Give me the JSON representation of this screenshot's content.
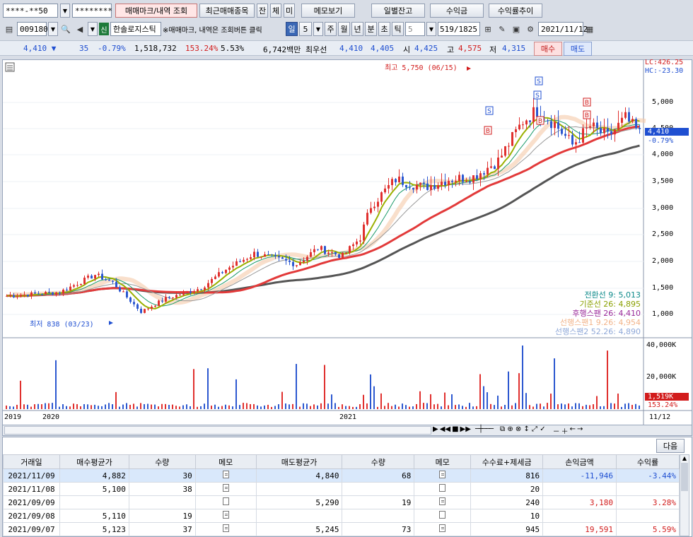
{
  "top": {
    "account": "****-**50",
    "password": "********",
    "btn_marks": "매매마크/내역 조회",
    "btn_recent": "최근매매종목",
    "btn_jan": "잔",
    "btn_che": "체",
    "btn_mi": "미",
    "btn_memo": "메모보기",
    "btn_daily": "일별잔고",
    "btn_profit": "수익금",
    "btn_rate": "수익률추이"
  },
  "stock": {
    "code": "009180",
    "badge": "신",
    "name": "한솔로지스틱",
    "hint": "※매매마크, 내역은 조회버튼 클릭",
    "periods": [
      "일",
      "5",
      "주",
      "월",
      "년",
      "분",
      "초",
      "틱"
    ],
    "interval": "5",
    "count": "519/1825",
    "date": "2021/11/12"
  },
  "quote": {
    "price": "4,410",
    "arrow": "▼",
    "change": "35",
    "rate": "-0.79%",
    "volume": "1,518,732",
    "vol_ratio": "153.24%",
    "turnover": "5.53%",
    "amount": "6,742백만",
    "best_label": "최우선",
    "bid": "4,410",
    "ask": "4,405",
    "open_label": "시",
    "open": "4,425",
    "high_label": "고",
    "high": "4,575",
    "low_label": "저",
    "low": "4,315",
    "buy_btn": "매수",
    "sell_btn": "매도"
  },
  "chart": {
    "lc": "LC:426.25",
    "hc": "HC:-23.30",
    "max_label": "최고 5,750 (06/15)",
    "min_label": "최저 838 (03/23)",
    "cur_price": "4,410",
    "cur_rate": "-0.79%",
    "price_ticks": [
      "5,000",
      "4,500",
      "4,000",
      "3,500",
      "3,000",
      "2,500",
      "2,000",
      "1,500",
      "1,000"
    ],
    "vol_ticks": [
      "40,000K",
      "20,000K"
    ],
    "vol_cur": "1,519K",
    "vol_rate": "153.24%",
    "x_labels": [
      "2019",
      "2020",
      "2021"
    ],
    "x_end": "11/12",
    "legend": [
      {
        "text": "전환선 9: 5,013",
        "color": "#0d8a8a"
      },
      {
        "text": "기준선 26: 4,895",
        "color": "#8aa000"
      },
      {
        "text": "후행스팬 26: 4,410",
        "color": "#9a2a9a"
      },
      {
        "text": "선행스팬1 9.26: 4,954",
        "color": "#f2b48a"
      },
      {
        "text": "선행스팬2 52.26: 4,890",
        "color": "#8fa8d8"
      }
    ],
    "marks": [
      "S",
      "S",
      "S",
      "B",
      "B",
      "B",
      "B"
    ]
  },
  "grid": {
    "next_btn": "다음",
    "headers": [
      "거래일",
      "매수평균가",
      "수량",
      "메모",
      "매도평균가",
      "수량",
      "메모",
      "수수료+제세금",
      "손익금액",
      "수익률"
    ],
    "rows": [
      {
        "date": "2021/11/09",
        "buy_avg": "4,882",
        "buy_qty": "30",
        "sell_avg": "4,840",
        "sell_qty": "68",
        "fee": "816",
        "pnl": "-11,946",
        "rate": "-3.44%",
        "sign": "down",
        "buy_memo": true,
        "sell_memo": true
      },
      {
        "date": "2021/11/08",
        "buy_avg": "5,100",
        "buy_qty": "38",
        "sell_avg": "",
        "sell_qty": "",
        "fee": "20",
        "pnl": "",
        "rate": "",
        "sign": "",
        "buy_memo": true,
        "sell_memo": false
      },
      {
        "date": "2021/09/09",
        "buy_avg": "",
        "buy_qty": "",
        "sell_avg": "5,290",
        "sell_qty": "19",
        "fee": "240",
        "pnl": "3,180",
        "rate": "3.28%",
        "sign": "up",
        "buy_memo": false,
        "sell_memo": true
      },
      {
        "date": "2021/09/08",
        "buy_avg": "5,110",
        "buy_qty": "19",
        "sell_avg": "",
        "sell_qty": "",
        "fee": "10",
        "pnl": "",
        "rate": "",
        "sign": "",
        "buy_memo": true,
        "sell_memo": false
      },
      {
        "date": "2021/09/07",
        "buy_avg": "5,123",
        "buy_qty": "37",
        "sell_avg": "5,245",
        "sell_qty": "73",
        "fee": "945",
        "pnl": "19,591",
        "rate": "5.59%",
        "sign": "up",
        "buy_memo": true,
        "sell_memo": true
      }
    ]
  }
}
